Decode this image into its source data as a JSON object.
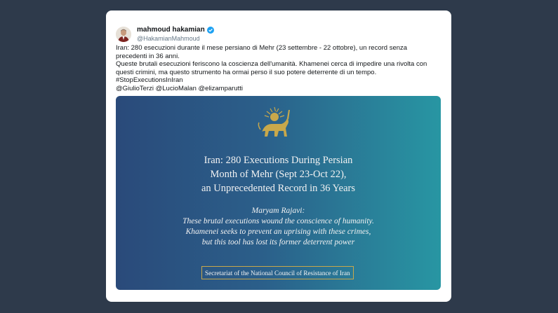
{
  "tweet": {
    "display_name": "mahmoud hakamian",
    "handle": "@HakamianMahmoud",
    "lines": [
      "Iran: 280 esecuzioni durante il mese persiano di Mehr (23 settembre - 22 ottobre), un record senza precedenti in 36 anni.",
      "Queste brutali esecuzioni feriscono la coscienza dell'umanità. Khamenei cerca di impedire una rivolta con questi crimini, ma questo strumento ha ormai perso il suo potere deterrente di un tempo.",
      "#StopExecutionsInIran",
      "@GiulioTerzi @LucioMalan @elizamparutti"
    ]
  },
  "media": {
    "headline": [
      "Iran: 280 Executions During Persian",
      "Month of Mehr (Sept 23-Oct 22),",
      "an Unprecedented Record in 36 Years"
    ],
    "quote": [
      "Maryam Rajavi:",
      "These brutal executions wound the conscience of humanity.",
      "Khamenei seeks to prevent an uprising with these crimes,",
      "but this tool has lost its former deterrent power"
    ],
    "footer": "Secretariat of the National Council of Resistance of Iran"
  },
  "icons": {
    "avatar": "user-avatar-icon",
    "verified": "verified-badge-icon",
    "emblem": "lion-and-sun-emblem-icon"
  },
  "colors": {
    "page_bg": "#2e3a4b",
    "card_bg": "#ffffff",
    "verified": "#1da1f2",
    "media_left": "#2a4a7a",
    "media_right": "#2896a3",
    "emblem": "#c8a84b"
  }
}
